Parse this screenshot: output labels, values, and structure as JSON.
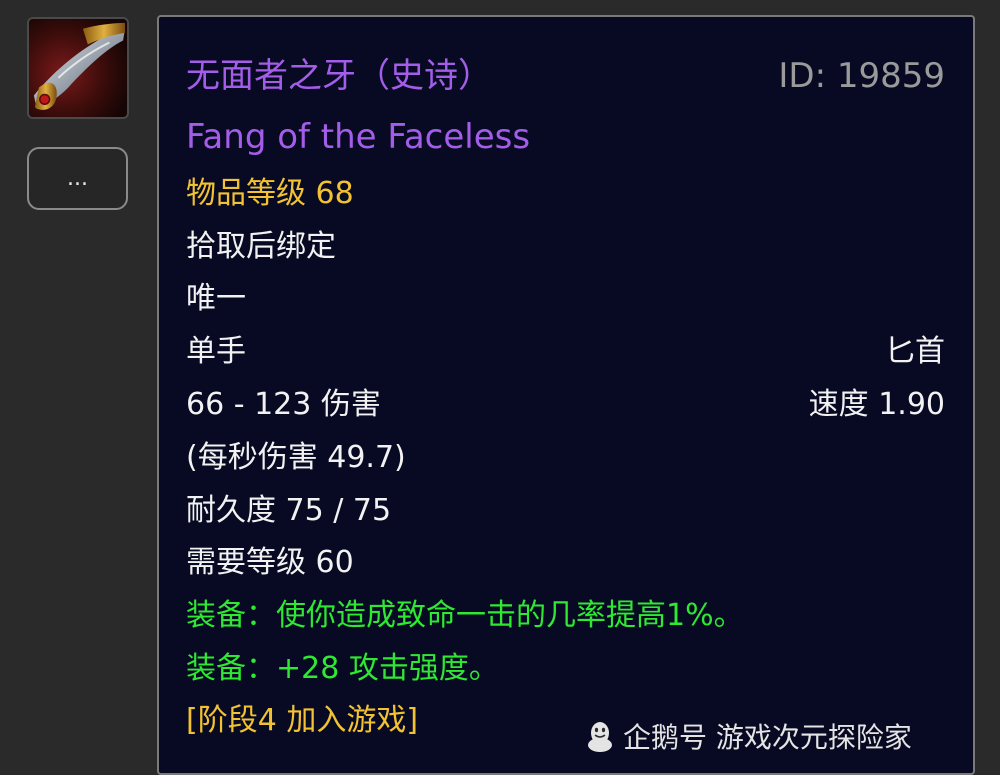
{
  "sidebar": {
    "item_icon": "dagger-item-icon",
    "more_button_label": "..."
  },
  "item": {
    "name_cn": "无面者之牙（史诗）",
    "id_label": "ID: 19859",
    "name_en": "Fang of the Faceless",
    "item_level": "物品等级 68",
    "binding": "拾取后绑定",
    "unique": "唯一",
    "slot": "单手",
    "weapon_type": "匕首",
    "damage": "66 - 123 伤害",
    "speed": "速度 1.90",
    "dps": "(每秒伤害 49.7)",
    "durability": "耐久度 75 / 75",
    "required_level": "需要等级 60",
    "equip_1": "装备：使你造成致命一击的几率提高1%。",
    "equip_2": "装备：+28 攻击强度。",
    "phase": "[阶段4 加入游戏]"
  },
  "watermark": {
    "text": "企鹅号 游戏次元探险家",
    "icon": "penguin-icon"
  },
  "colors": {
    "epic": "#a35de8",
    "gold": "#f2c232",
    "green": "#2ee832",
    "text": "#f2f2f2",
    "tooltip_bg": "#070a22"
  }
}
